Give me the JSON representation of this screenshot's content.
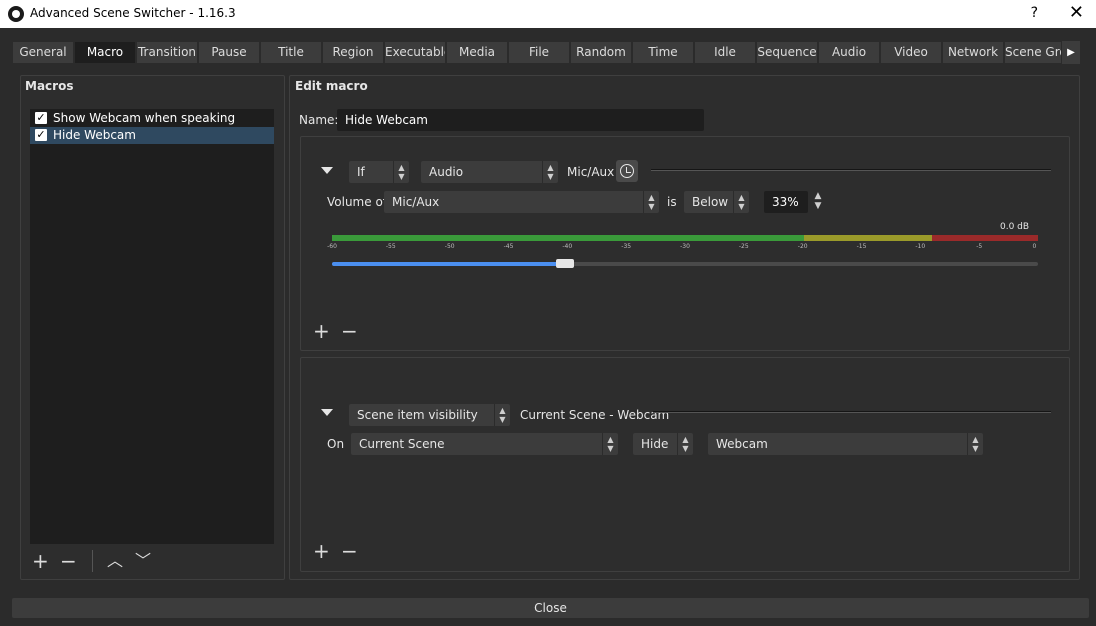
{
  "window": {
    "title": "Advanced Scene Switcher - 1.16.3",
    "help": "?",
    "close": "✕"
  },
  "tabs": [
    "General",
    "Macro",
    "Transition",
    "Pause",
    "Title",
    "Region",
    "Executable",
    "Media",
    "File",
    "Random",
    "Time",
    "Idle",
    "Sequence",
    "Audio",
    "Video",
    "Network",
    "Scene Gro"
  ],
  "active_tab": "Macro",
  "macros_panel": {
    "title": "Macros",
    "items": [
      {
        "label": "Show Webcam when speaking",
        "checked": true,
        "selected": false
      },
      {
        "label": "Hide Webcam",
        "checked": true,
        "selected": true
      }
    ]
  },
  "edit_panel": {
    "title": "Edit macro",
    "name_label": "Name:",
    "name_value": "Hide Webcam",
    "condition": {
      "logic": "If",
      "type": "Audio",
      "summary": "Mic/Aux",
      "volume_label": "Volume of",
      "source": "Mic/Aux",
      "is_label": "is",
      "comparison": "Below",
      "threshold": "33%",
      "threshold_fraction": 0.33,
      "meter_db_label": "0.0 dB",
      "meter_ticks": [
        "-60",
        "-55",
        "-50",
        "-45",
        "-40",
        "-35",
        "-30",
        "-25",
        "-20",
        "-15",
        "-10",
        "-5",
        "0"
      ]
    },
    "action": {
      "type": "Scene item visibility",
      "summary": "Current Scene - Webcam",
      "on_label": "On",
      "scene": "Current Scene",
      "visibility": "Hide",
      "item": "Webcam"
    }
  },
  "buttons": {
    "add": "+",
    "remove": "−",
    "up": "︿",
    "down": "﹀",
    "close": "Close"
  },
  "colors": {
    "meter_green": "#3a9a3a",
    "meter_yellow": "#9a9a2a",
    "meter_red": "#9a2a2a",
    "slider_blue": "#4b8ff0"
  }
}
